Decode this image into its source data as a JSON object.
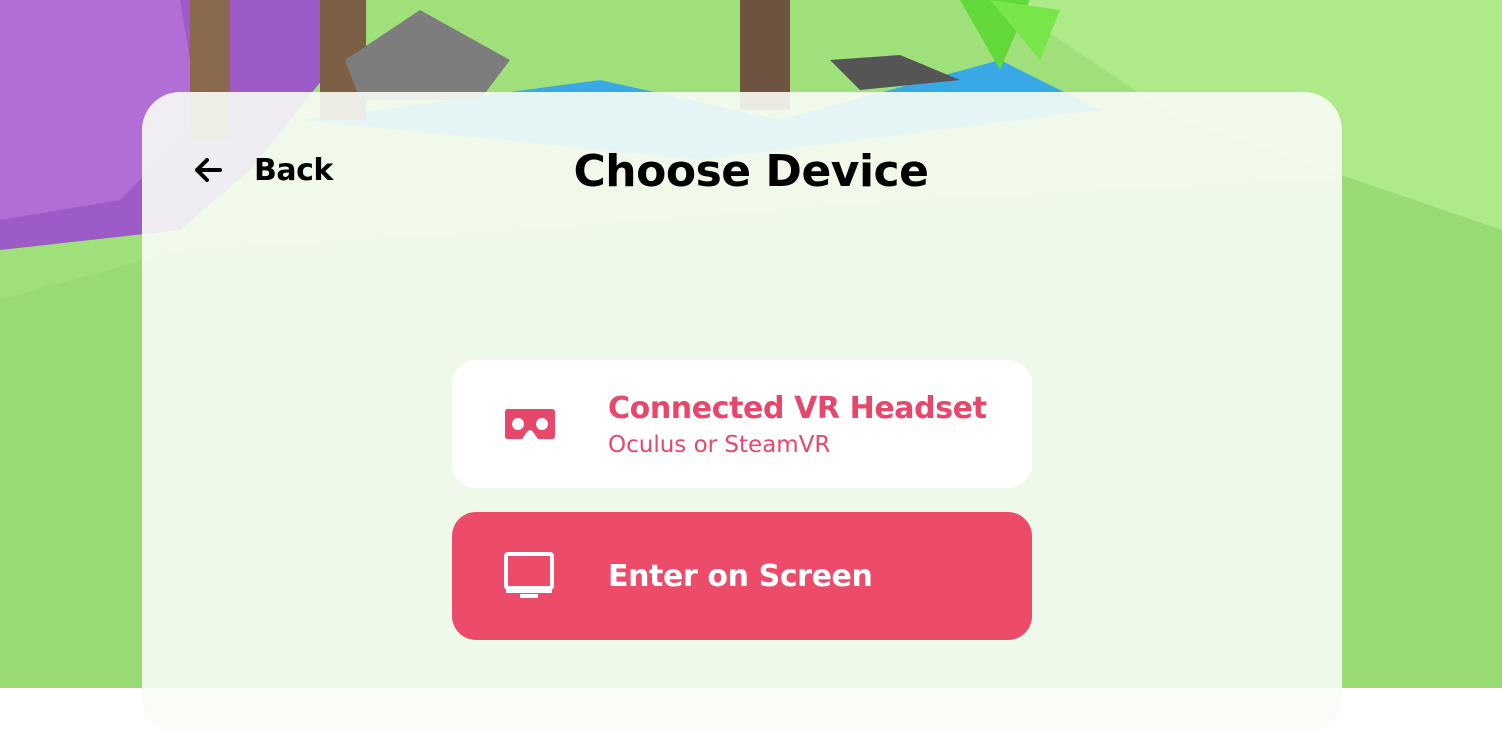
{
  "header": {
    "back_label": "Back",
    "title": "Choose Device"
  },
  "options": [
    {
      "title": "Connected VR Headset",
      "subtitle": "Oculus or SteamVR",
      "icon": "vr-headset-icon",
      "selected": false
    },
    {
      "title": "Enter on Screen",
      "icon": "monitor-icon",
      "selected": true
    }
  ],
  "colors": {
    "accent": "#ec4b69",
    "accent_text": "#e6476a",
    "panel": "#f8fcf6",
    "grass": "#a7e680"
  }
}
